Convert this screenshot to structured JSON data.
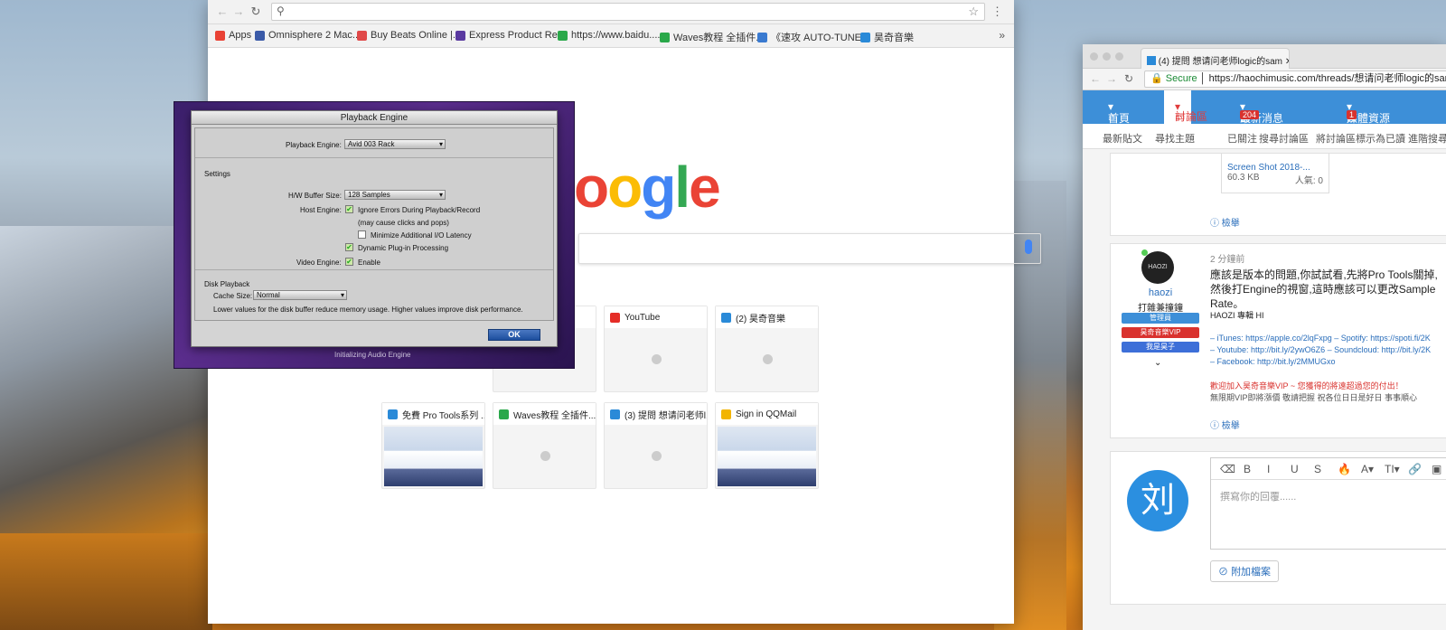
{
  "chrome": {
    "bookmarks": [
      {
        "label": "Apps",
        "color": "#e94235"
      },
      {
        "label": "Omnisphere 2 Mac...",
        "color": "#3a5aa8"
      },
      {
        "label": "Buy Beats Online |...",
        "color": "#e04848"
      },
      {
        "label": "Express Product Re...",
        "color": "#5a3aa0"
      },
      {
        "label": "https://www.baidu....",
        "color": "#2aa84a"
      },
      {
        "label": "Waves教程 全插件...",
        "color": "#2aa84a"
      },
      {
        "label": "《速攻 AUTO-TUNE...",
        "color": "#3a7ad0"
      },
      {
        "label": "昊奇音樂",
        "color": "#2a8ad8"
      }
    ],
    "more": "»",
    "logo_text": "oogle",
    "tiles": [
      {
        "title": "uy Be...",
        "fav": "#d33",
        "shot": false
      },
      {
        "title": "YouTube",
        "fav": "#e52d27",
        "shot": false
      },
      {
        "title": "(2) 昊奇音樂",
        "fav": "#2a8ad8",
        "shot": false
      },
      {
        "title": "免費 Pro Tools系列 ...",
        "fav": "#2a8ad8",
        "shot": true
      },
      {
        "title": "Waves教程 全插件...",
        "fav": "#2aa84a",
        "shot": false
      },
      {
        "title": "(3) 提問 想请问老师l...",
        "fav": "#2a8ad8",
        "shot": false
      },
      {
        "title": "Sign in QQMail",
        "fav": "#f2b400",
        "shot": true
      }
    ]
  },
  "protools": {
    "title": "Playback Engine",
    "engine_label": "Playback Engine:",
    "engine_value": "Avid 003 Rack",
    "settings": "Settings",
    "buffer_label": "H/W Buffer Size:",
    "buffer_value": "128 Samples",
    "host_label": "Host Engine:",
    "ignore_errors": "Ignore Errors During Playback/Record",
    "may_cause": "(may cause clicks and pops)",
    "min_latency": "Minimize Additional I/O Latency",
    "dynamic": "Dynamic Plug-in Processing",
    "video_label": "Video Engine:",
    "enable": "Enable",
    "disk_playback": "Disk Playback",
    "cache_label": "Cache Size:",
    "cache_value": "Normal",
    "hint": "Lower values for the disk buffer reduce memory usage.  Higher values improve disk performance.",
    "ok": "OK",
    "status": "Initializing Audio Engine"
  },
  "forum": {
    "tab_title": "(4) 提問 想请问老师logic的sam",
    "secure": "Secure",
    "url": "https://haochimusic.com/threads/想请问老师logic的samp",
    "nav": {
      "home": "首頁",
      "discuss": "討論區",
      "latest": "最新消息",
      "latest_badge": "204",
      "media": "媒體資源",
      "media_badge": "1"
    },
    "subnav": [
      "最新貼文",
      "尋找主題",
      "已關注",
      "搜尋討論區",
      "將討論區標示為已讀",
      "進階搜尋"
    ],
    "attachment": {
      "name": "Screen Shot 2018-...",
      "size": "60.3 KB",
      "views": "人氣: 0"
    },
    "report": "檢舉",
    "post": {
      "time": "2 分鐘前",
      "user": "haozi",
      "user_title": "打雜兼撞鐘",
      "roles": [
        "管理員",
        "昊奇音樂VIP",
        "我是昊子"
      ],
      "body": "應該是版本的問題,你試試看,先將Pro Tools關掉,然後打Engine的視窗,這時應該可以更改Sample Rate。",
      "sig_title": "HAOZI 專輯 HI",
      "sig_lines": [
        "– iTunes: https://apple.co/2lqFxpg – Spotify: https://spoti.fi/2K",
        "– Youtube: http://bit.ly/2ywO6Z6 – Soundcloud: http://bit.ly/2K",
        "– Facebook: http://bit.ly/2MMUGxo"
      ],
      "promo": "歡迎加入昊奇音樂VIP ~ 您獲得的將遠超過您的付出！",
      "promo2": "無限期VIP即將漲價 敬請把握 祝各位日日是好日 事事順心"
    },
    "reply": {
      "avatar": "刘",
      "placeholder": "撰寫你的回覆......",
      "attach": "附加檔案",
      "toolbar": [
        "⌫",
        "B",
        "I",
        "U",
        "S",
        "🔥",
        "A▾",
        "TI▾",
        "🔗",
        "▣"
      ]
    }
  }
}
